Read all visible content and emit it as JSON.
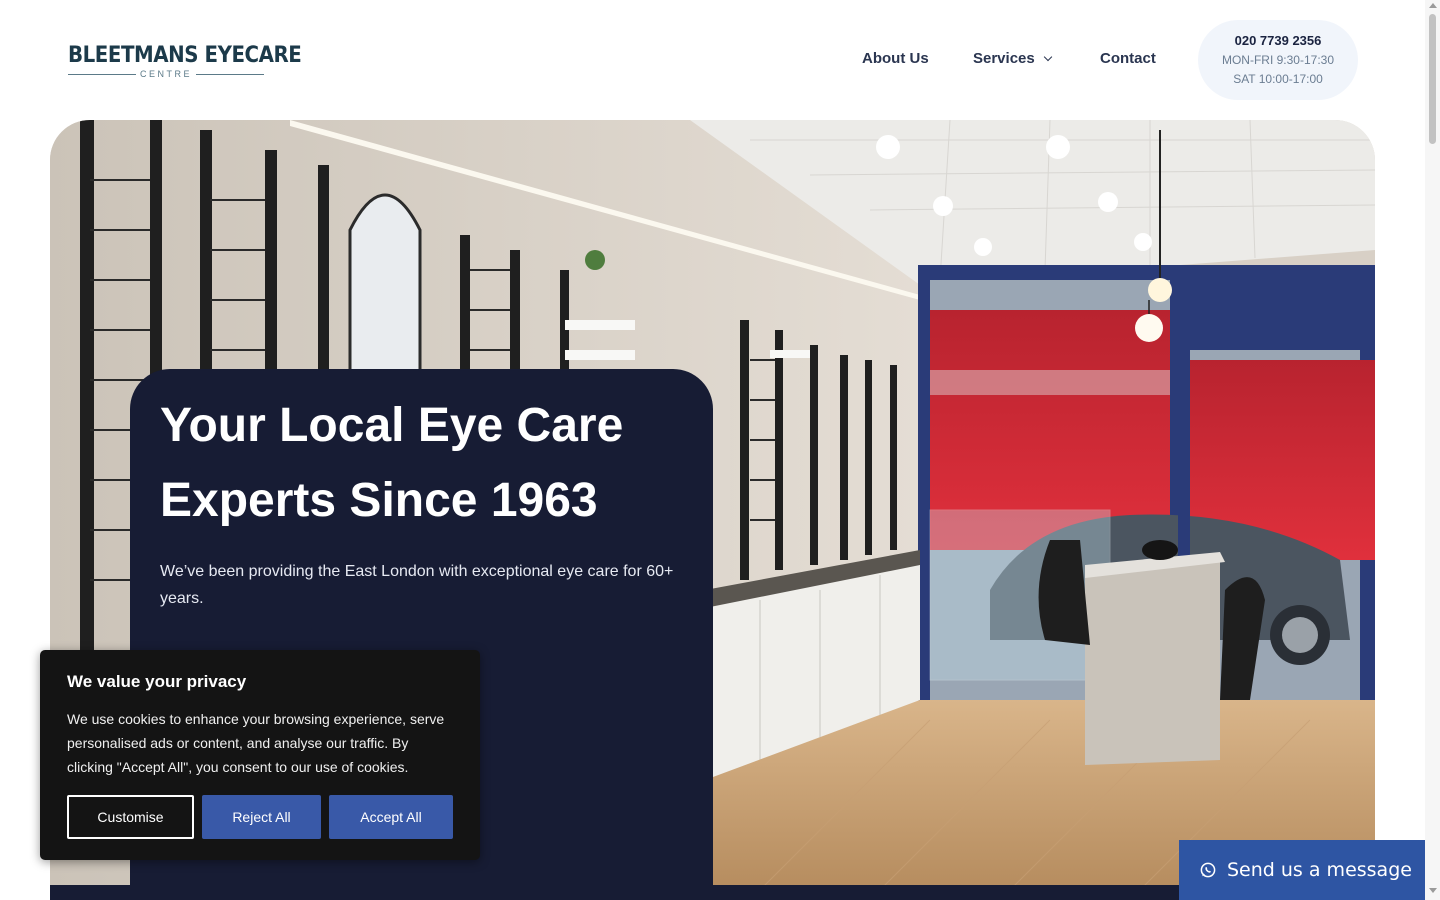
{
  "header": {
    "logo": {
      "main": "BLEETMANS EYECARE",
      "sub": "CENTRE"
    },
    "nav": [
      {
        "label": "About Us"
      },
      {
        "label": "Services",
        "has_dropdown": true
      },
      {
        "label": "Contact"
      }
    ],
    "contact": {
      "phone": "020 7739 2356",
      "hours_weekday": "MON-FRI 9:30-17:30",
      "hours_saturday": "SAT 10:00-17:00"
    }
  },
  "hero": {
    "title": "Your Local Eye Care Experts Since 1963",
    "subtitle": "We’ve been providing the East London with exceptional eye care for 60+ years.",
    "card_color": "#171c34"
  },
  "cookie_banner": {
    "title": "We value your privacy",
    "text": "We use cookies to enhance your browsing experience, serve personalised ads or content, and analyse our traffic. By clicking \"Accept All\", you consent to our use of cookies.",
    "buttons": {
      "customise": "Customise",
      "reject": "Reject All",
      "accept": "Accept All"
    },
    "button_color": "#3959a8"
  },
  "chat_widget": {
    "label": "Send us a message",
    "icon": "whatsapp-icon",
    "color": "#2e55a3"
  }
}
